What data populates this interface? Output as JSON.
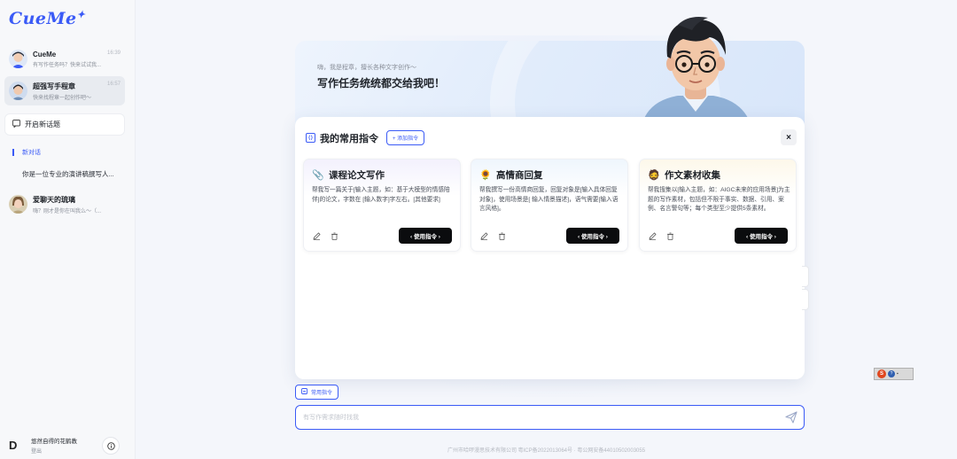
{
  "app": {
    "logo": "CueMe",
    "logo_mark": "✦"
  },
  "sidebar": {
    "conversations": [
      {
        "title": "CueMe",
        "subtitle": "有写作任务吗？快来试试我...",
        "time": "16:39"
      },
      {
        "title": "超强写手程章",
        "subtitle": "快来找程章一起创作吧～",
        "time": "16:57"
      },
      {
        "title": "爱聊天的琉璃",
        "subtitle": "嗨？刚才是你在叫我么～（...",
        "time": ""
      }
    ],
    "new_topic_label": "开启新话题",
    "tree_head": "新对话",
    "tree_item": "你是一位专业的演讲稿撰写人...",
    "user_name": "悠然自得的花鹤教",
    "user_action": "登出",
    "user_icon": "D"
  },
  "hero": {
    "greet_small": "嗨，我是程章，擅长各种文字创作～",
    "greet_big": "写作任务统统都交给我吧！"
  },
  "panel": {
    "title": "我的常用指令",
    "add_label": "+ 添加指令",
    "close_label": "×",
    "cards": [
      {
        "emoji": "📎",
        "title": "课程论文写作",
        "desc": "帮我写一篇关于[输入主题，如：基于大模型的情感陪伴]的论文，字数在 [输入数字]字左右。[其他要求]",
        "button": "‹ 使用指令 ›"
      },
      {
        "emoji": "🌻",
        "title": "高情商回复",
        "desc": "帮我撰写一份高情商回复，回复对象是[输入具体回复对象]，使用场景是[ 输入情景描述]，语气需要[输入语言风格]。",
        "button": "‹ 使用指令 ›"
      },
      {
        "emoji": "🧔",
        "title": "作文素材收集",
        "desc": "帮我搜集以[输入主题，如：AIGC未来的应用场景]为主题的写作素材，包括但不限于事实、数据、引用、案例、名言警句等；每个类型至少提供5条素材。",
        "button": "‹ 使用指令 ›"
      }
    ]
  },
  "bottom": {
    "cmd_chip": "常用指令",
    "input_placeholder": "有写作需求随时找我",
    "footer": "广州市哈啰漫思技术有限公司 粤ICP备2022013064号 · 粤公网安备44010502003055"
  },
  "ime": {
    "s": "S",
    "q": "?",
    "d": "▪"
  },
  "colors": {
    "accent": "#3b5bf6",
    "button_dark": "#0b0c0e"
  }
}
